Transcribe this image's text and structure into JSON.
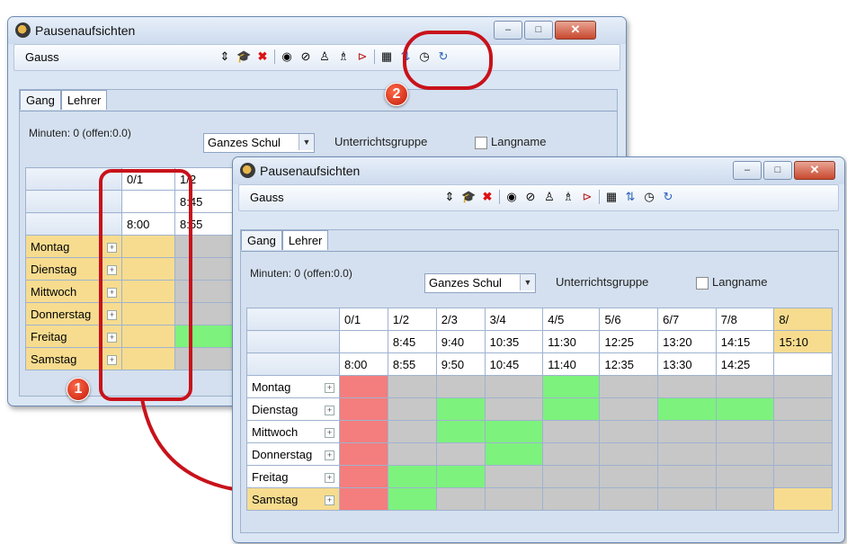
{
  "window": {
    "title": "Pausenaufsichten",
    "toolbar_combo_value": "Gauss",
    "controls": {
      "minimize": "–",
      "maximize": "□",
      "close": "✕"
    }
  },
  "toolbar_icons": [
    "spin-icon",
    "graduation-cap-icon",
    "delete-icon",
    "eye-icon",
    "eye-off-icon",
    "assign-teacher-icon",
    "assign-teachers-icon",
    "print-settings-icon",
    "calculator-icon",
    "transfer-icon",
    "clock-icon",
    "refresh-icon"
  ],
  "tabs": [
    "Gang",
    "Lehrer"
  ],
  "info": {
    "minutes": "Minuten: 0 (offen:0.0)",
    "scope_select": "Ganzes Schul",
    "group_label": "Unterrichtsgruppe",
    "longname_label": "Langname"
  },
  "back_grid": {
    "periods": [
      "0/1",
      "1/2"
    ],
    "row2": [
      "",
      "8:45"
    ],
    "row3": [
      "8:00",
      "8:55"
    ],
    "days": [
      "Montag",
      "Dienstag",
      "Mittwoch",
      "Donnerstag",
      "Freitag",
      "Samstag"
    ]
  },
  "front_grid": {
    "periods": [
      "0/1",
      "1/2",
      "2/3",
      "3/4",
      "4/5",
      "5/6",
      "6/7",
      "7/8",
      "8/"
    ],
    "ends": [
      "",
      "8:45",
      "9:40",
      "10:35",
      "11:30",
      "12:25",
      "13:20",
      "14:15",
      "15:10"
    ],
    "starts": [
      "8:00",
      "8:55",
      "9:50",
      "10:45",
      "11:40",
      "12:35",
      "13:30",
      "14:25",
      ""
    ],
    "days": [
      "Montag",
      "Dienstag",
      "Mittwoch",
      "Donnerstag",
      "Freitag",
      "Samstag"
    ],
    "cells": [
      [
        "red",
        "gray",
        "gray",
        "gray",
        "green",
        "gray",
        "gray",
        "gray",
        "gray"
      ],
      [
        "red",
        "gray",
        "green",
        "gray",
        "green",
        "gray",
        "green",
        "green",
        "gray"
      ],
      [
        "red",
        "gray",
        "green",
        "green",
        "gray",
        "gray",
        "gray",
        "gray",
        "gray"
      ],
      [
        "red",
        "gray",
        "gray",
        "green",
        "gray",
        "gray",
        "gray",
        "gray",
        "gray"
      ],
      [
        "red",
        "green",
        "green",
        "gray",
        "gray",
        "gray",
        "gray",
        "gray",
        "gray"
      ],
      [
        "red",
        "green",
        "gray",
        "gray",
        "gray",
        "gray",
        "gray",
        "gray",
        "yellow"
      ]
    ]
  },
  "markers": {
    "m1": "1",
    "m2": "2"
  },
  "colors": {
    "highlight": "#c8121b",
    "selected_day": "#f7dc8f"
  }
}
